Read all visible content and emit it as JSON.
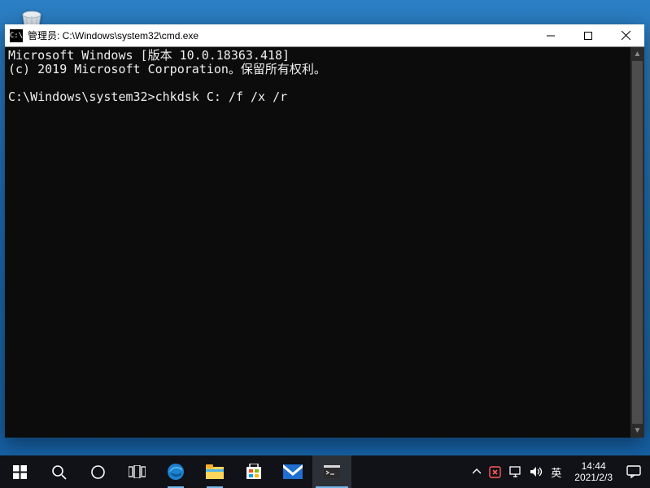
{
  "window": {
    "title": "管理员: C:\\Windows\\system32\\cmd.exe",
    "app_icon_text": "C:\\"
  },
  "terminal": {
    "line1": "Microsoft Windows [版本 10.0.18363.418]",
    "line2": "(c) 2019 Microsoft Corporation。保留所有权利。",
    "blank": "",
    "prompt": "C:\\Windows\\system32>",
    "command": "chkdsk C: /f /x /r"
  },
  "tray": {
    "ime": "英",
    "time": "14:44",
    "date": "2021/2/3"
  },
  "icons": {
    "recycle_bin": "recycle-bin"
  }
}
